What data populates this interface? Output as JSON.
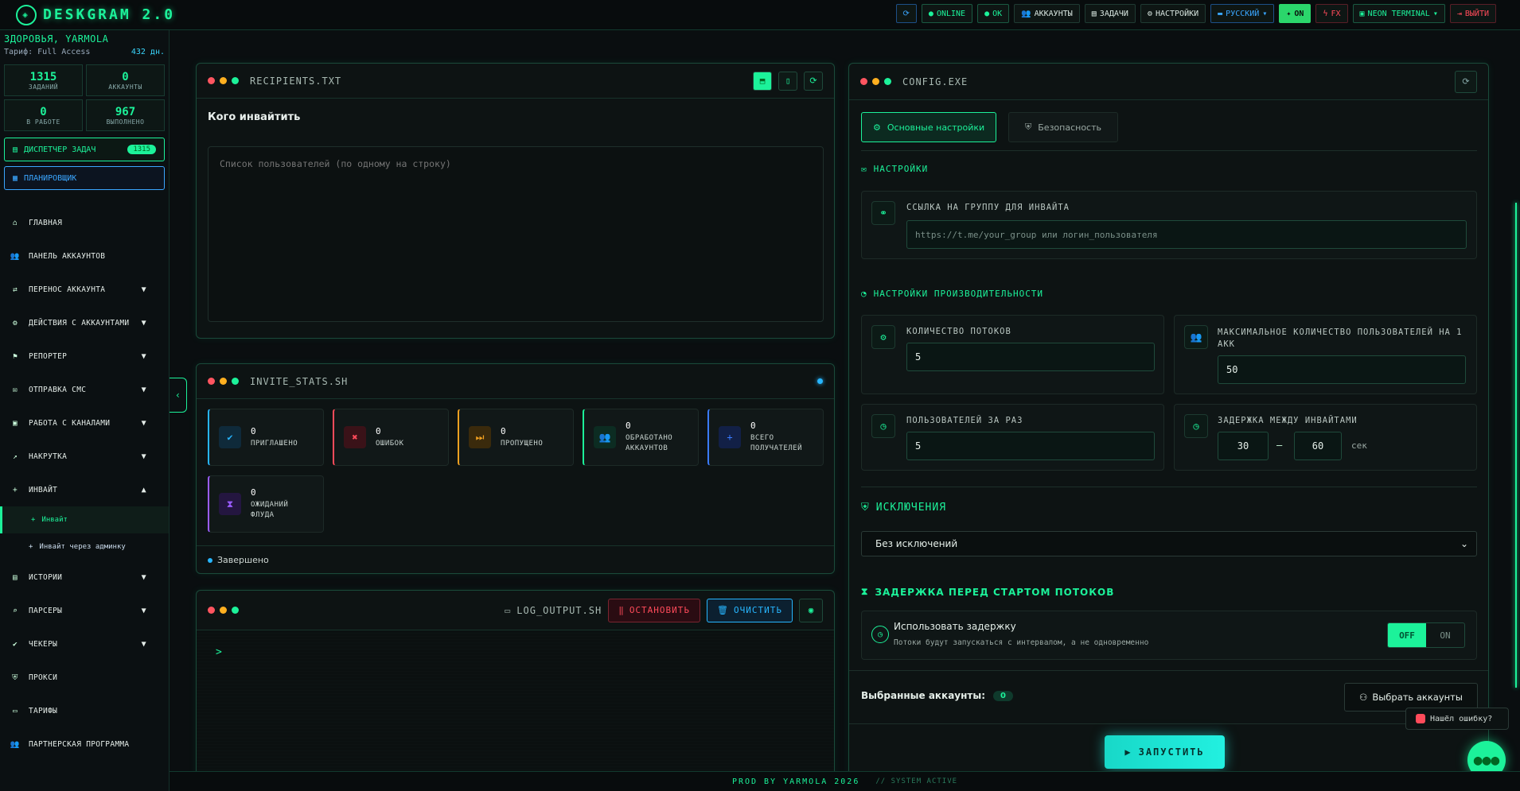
{
  "app": {
    "logo_text": "DESKGRAM 2.0"
  },
  "topbar": {
    "refresh_icon": "refresh-icon",
    "online": "ONLINE",
    "ok": "OK",
    "accounts": "АККАУНТЫ",
    "tasks": "ЗАДАЧИ",
    "settings": "НАСТРОЙКИ",
    "language": "РУССКИЙ",
    "on": "ON",
    "fx": "FX",
    "theme": "NEON TERMINAL",
    "logout": "ВЫЙТИ"
  },
  "sidebar": {
    "user": "ЗДОРОВЬЯ, YARMOLA",
    "tariff_label": "Тариф: Full Access",
    "days_left": "432 дн.",
    "stats": [
      {
        "value": "1315",
        "label": "ЗАДАНИЙ"
      },
      {
        "value": "0",
        "label": "АККАУНТЫ"
      },
      {
        "value": "0",
        "label": "В РАБОТЕ"
      },
      {
        "value": "967",
        "label": "ВЫПОЛНЕНО"
      }
    ],
    "task_manager": "ДИСПЕТЧЕР ЗАДАЧ",
    "task_manager_badge": "1315",
    "scheduler": "ПЛАНИРОВЩИК",
    "nav": [
      {
        "label": "ГЛАВНАЯ",
        "icon": "home-icon",
        "chevron": false
      },
      {
        "label": "ПАНЕЛЬ АККАУНТОВ",
        "icon": "users-icon",
        "chevron": false
      },
      {
        "label": "ПЕРЕНОС АККАУНТА",
        "icon": "user-transfer-icon",
        "chevron": true
      },
      {
        "label": "ДЕЙСТВИЯ С АККАУНТАМИ",
        "icon": "user-cog-icon",
        "chevron": true
      },
      {
        "label": "РЕПОРТЕР",
        "icon": "flag-icon",
        "chevron": true
      },
      {
        "label": "ОТПРАВКА СМС",
        "icon": "chat-icon",
        "chevron": true
      },
      {
        "label": "РАБОТА С КАНАЛАМИ",
        "icon": "briefcase-icon",
        "chevron": true
      },
      {
        "label": "НАКРУТКА",
        "icon": "chart-icon",
        "chevron": true
      },
      {
        "label": "ИНВАЙТ",
        "icon": "user-plus-icon",
        "chevron": "up"
      }
    ],
    "sub": [
      {
        "label": "Инвайт",
        "active": true
      },
      {
        "label": "Инвайт через админку",
        "active": false
      }
    ],
    "nav2": [
      {
        "label": "ИСТОРИИ",
        "icon": "stories-icon",
        "chevron": true
      },
      {
        "label": "ПАРСЕРЫ",
        "icon": "search-icon",
        "chevron": true
      },
      {
        "label": "ЧЕКЕРЫ",
        "icon": "check-circle-icon",
        "chevron": true
      },
      {
        "label": "ПРОКСИ",
        "icon": "shield-icon",
        "chevron": false
      },
      {
        "label": "ТАРИФЫ",
        "icon": "card-icon",
        "chevron": false
      },
      {
        "label": "ПАРТНЕРСКАЯ ПРОГРАММА",
        "icon": "partner-icon",
        "chevron": false
      }
    ]
  },
  "recipients": {
    "title": "RECIPIENTS.TXT",
    "heading": "Кого инвайтить",
    "placeholder": "Список пользователей (по одному на строку)"
  },
  "invite_stats": {
    "title": "INVITE_STATS.SH",
    "cards": [
      {
        "value": "0",
        "label1": "ПРИГЛАШЕНО",
        "label2": "",
        "color": "#27b6ff",
        "icon": "check-icon"
      },
      {
        "value": "0",
        "label1": "ОШИБОК",
        "label2": "",
        "color": "#ff4b5a",
        "icon": "x-icon"
      },
      {
        "value": "0",
        "label1": "ПРОПУЩЕНО",
        "label2": "",
        "color": "#f0a020",
        "icon": "skip-icon"
      },
      {
        "value": "0",
        "label1": "ОБРАБОТАНО",
        "label2": "АККАУНТОВ",
        "color": "#1cf29a",
        "icon": "users-icon"
      },
      {
        "value": "0",
        "label1": "ВСЕГО",
        "label2": "ПОЛУЧАТЕЛЕЙ",
        "color": "#3a7bff",
        "icon": "user-add-icon"
      },
      {
        "value": "0",
        "label1": "ОЖИДАНИЙ",
        "label2": "ФЛУДА",
        "color": "#9a5cff",
        "icon": "hourglass-icon"
      }
    ],
    "status": "Завершено"
  },
  "log": {
    "title": "LOG_OUTPUT.SH",
    "stop": "ОСТАНОВИТЬ",
    "clear": "ОЧИСТИТЬ",
    "prompt": ">"
  },
  "config": {
    "title": "CONFIG.EXE",
    "tab_main": "Основные настройки",
    "tab_security": "Безопасность",
    "settings_h": "НАСТРОЙКИ",
    "group_label": "ССЫЛКА НА ГРУППУ ДЛЯ ИНВАЙТА",
    "group_placeholder": "https://t.me/your_group или логин_пользователя",
    "perf_h": "НАСТРОЙКИ ПРОИЗВОДИТЕЛЬНОСТИ",
    "threads_label": "КОЛИЧЕСТВО ПОТОКОВ",
    "threads_value": "5",
    "max_users_label1": "МАКСИМАЛЬНОЕ КОЛИЧЕСТВО ПОЛЬЗОВАТЕЛЕЙ НА 1",
    "max_users_label2": "АКК",
    "max_users_value": "50",
    "per_batch_label": "ПОЛЬЗОВАТЕЛЕЙ ЗА РАЗ",
    "per_batch_value": "5",
    "delay_label": "ЗАДЕРЖКА МЕЖДУ ИНВАЙТАМИ",
    "delay_from": "30",
    "delay_dash": "—",
    "delay_to": "60",
    "delay_unit": "сек",
    "exclusions_h": "ИСКЛЮЧЕНИЯ",
    "exclusions_value": "Без исключений",
    "start_delay_h": "ЗАДЕРЖКА ПЕРЕД СТАРТОМ ПОТОКОВ",
    "use_delay": "Использовать задержку",
    "use_delay_hint": "Потоки будут запускаться с интервалом, а не одновременно",
    "toggle_off": "OFF",
    "toggle_on": "ON",
    "selected_accounts": "Выбранные аккаунты:",
    "selected_count": "0",
    "choose_accounts": "Выбрать аккаунты",
    "start": "ЗАПУСТИТЬ"
  },
  "floating": {
    "bug_report": "Нашёл ошибку?"
  },
  "footer": {
    "credit": "PROD BY YARMOLA 2026",
    "status": "// SYSTEM ACTIVE"
  }
}
